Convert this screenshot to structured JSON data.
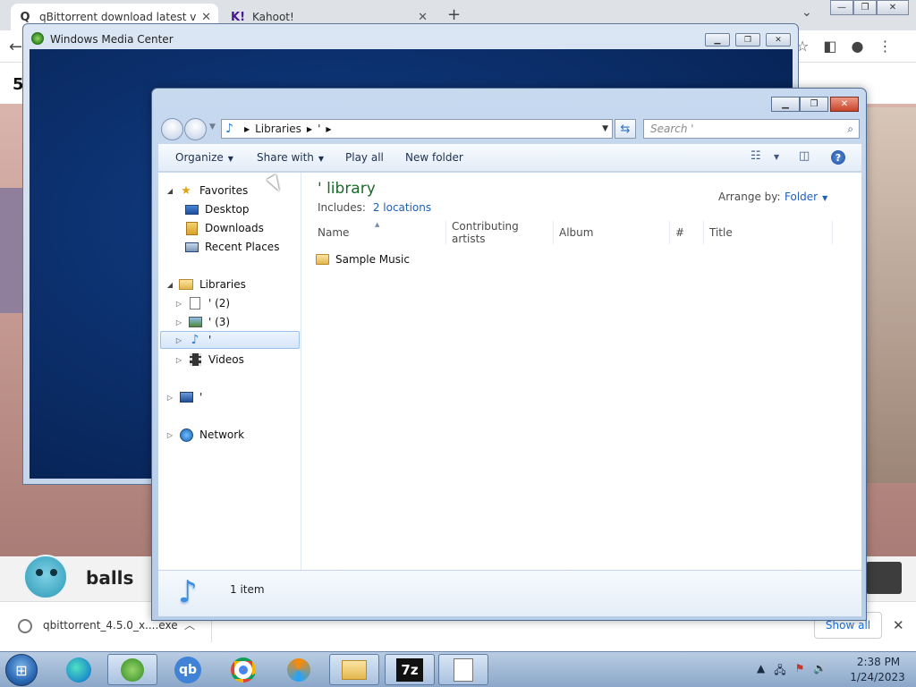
{
  "browser": {
    "tabs": [
      {
        "icon": "Q",
        "title": "qBittorrent download latest versi",
        "close": "✕"
      },
      {
        "icon": "K!",
        "title": "Kahoot!",
        "close": "✕"
      }
    ],
    "new_tab": "+",
    "page_number": "5",
    "player_name": "balls",
    "download_filename": "qbittorrent_4.5.0_x....exe",
    "show_all": "Show all"
  },
  "wmc": {
    "title": "Windows Media Center"
  },
  "explorer": {
    "address": {
      "root": "Libraries",
      "current": "'"
    },
    "search_placeholder": "Search '",
    "toolbar": {
      "organize": "Organize",
      "share_with": "Share with",
      "play_all": "Play all",
      "new_folder": "New folder"
    },
    "nav": {
      "favorites": "Favorites",
      "desktop": "Desktop",
      "downloads": "Downloads",
      "recent_places": "Recent Places",
      "libraries": "Libraries",
      "lib_docs": "' (2)",
      "lib_pictures": "' (3)",
      "lib_music": "'",
      "videos": "Videos",
      "computer": "'",
      "network": "Network"
    },
    "library": {
      "title": "' library",
      "includes_label": "Includes:",
      "locations": "2 locations",
      "arrange_label": "Arrange by:",
      "arrange_value": "Folder"
    },
    "columns": [
      "Name",
      "Contributing artists",
      "Album",
      "#",
      "Title"
    ],
    "files": [
      {
        "name": "Sample Music"
      }
    ],
    "status": "1 item"
  },
  "taskbar": {
    "qb_label": "qb",
    "zip_label": "7z",
    "time": "2:38 PM",
    "date": "1/24/2023"
  }
}
